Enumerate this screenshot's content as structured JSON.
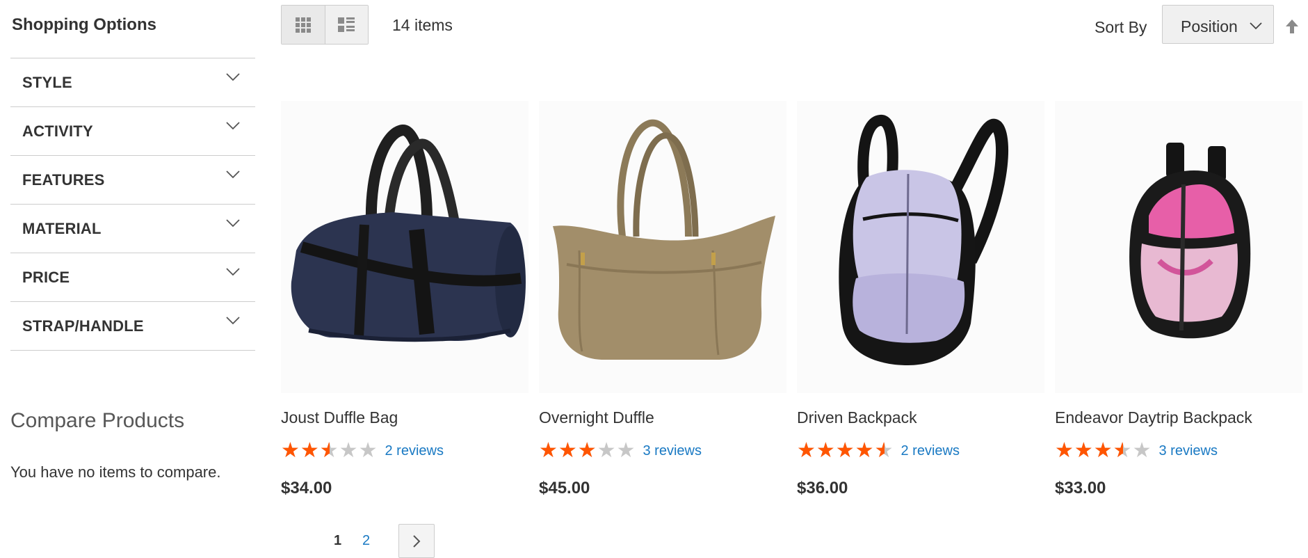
{
  "sidebar": {
    "title": "Shopping Options",
    "filters": [
      {
        "label": "STYLE"
      },
      {
        "label": "ACTIVITY"
      },
      {
        "label": "FEATURES"
      },
      {
        "label": "MATERIAL"
      },
      {
        "label": "PRICE"
      },
      {
        "label": "STRAP/HANDLE"
      }
    ],
    "compare_title": "Compare Products",
    "compare_empty": "You have no items to compare."
  },
  "toolbar": {
    "view_modes": [
      {
        "name": "grid",
        "icon": "grid-icon",
        "active": true
      },
      {
        "name": "list",
        "icon": "list-icon",
        "active": false
      }
    ],
    "amount": "14 items",
    "sort_label": "Sort By",
    "sort_value": "Position",
    "sort_direction_icon": "arrow-up-icon"
  },
  "products": [
    {
      "name": "Joust Duffle Bag",
      "rating": 0.5,
      "reviews": "2 reviews",
      "price": "$34.00",
      "image": "duffle-bag-navy"
    },
    {
      "name": "Overnight Duffle",
      "rating": 0.6,
      "reviews": "3 reviews",
      "price": "$45.00",
      "image": "duffle-bag-tan"
    },
    {
      "name": "Driven Backpack",
      "rating": 0.9,
      "reviews": "2 reviews",
      "price": "$36.00",
      "image": "backpack-lavender"
    },
    {
      "name": "Endeavor Daytrip Backpack",
      "rating": 0.7,
      "reviews": "3 reviews",
      "price": "$33.00",
      "image": "backpack-pink"
    }
  ],
  "pagination": {
    "current": "1",
    "pages": [
      "2"
    ],
    "next_icon": "chevron-right-icon"
  },
  "colors": {
    "star": "#ff5501",
    "link": "#1979c3",
    "text": "#333333"
  }
}
